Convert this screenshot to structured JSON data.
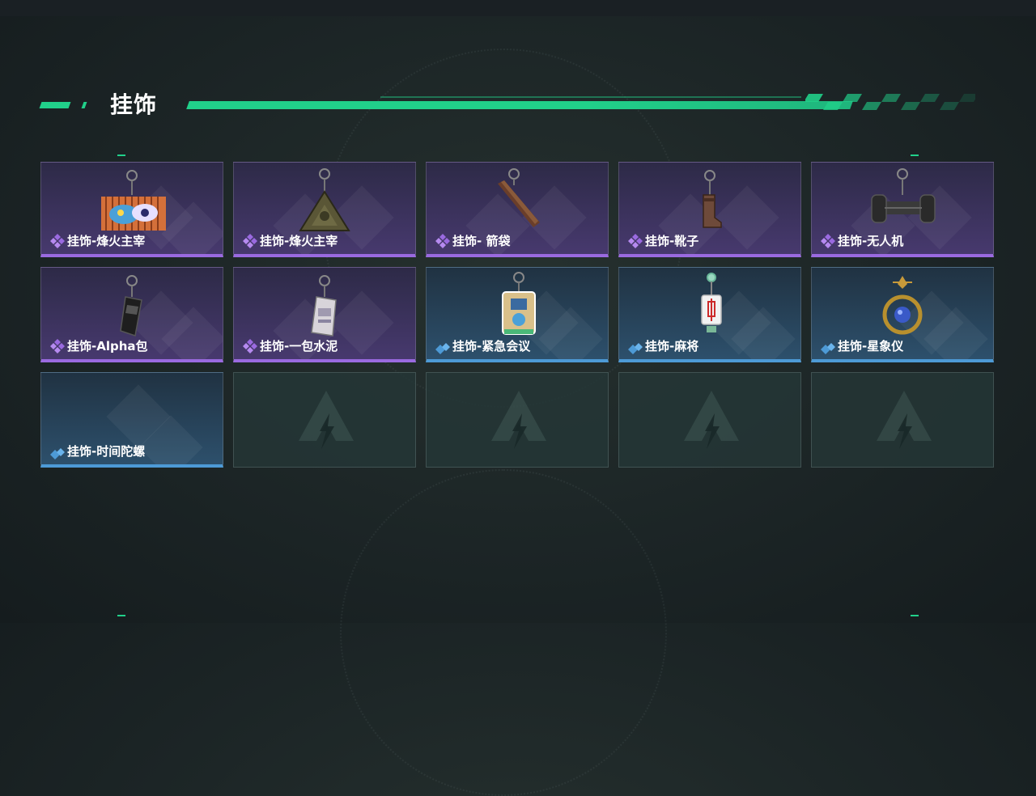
{
  "page": {
    "title": "挂饰"
  },
  "colors": {
    "accent": "#21d08a",
    "purple": "#9a6ae0",
    "blue": "#4d9ad6"
  },
  "items": [
    {
      "name": "挂饰-烽火主宰",
      "rarity": "purple",
      "icon": "colorful-panel-charm-icon"
    },
    {
      "name": "挂饰-烽火主宰",
      "rarity": "purple",
      "icon": "triangle-pendant-charm-icon"
    },
    {
      "name": "挂饰- 箭袋",
      "rarity": "purple",
      "icon": "quiver-charm-icon"
    },
    {
      "name": "挂饰-靴子",
      "rarity": "purple",
      "icon": "boot-charm-icon"
    },
    {
      "name": "挂饰-无人机",
      "rarity": "purple",
      "icon": "drone-charm-icon"
    },
    {
      "name": "挂饰-Alpha包",
      "rarity": "purple",
      "icon": "alpha-bag-charm-icon"
    },
    {
      "name": "挂饰-一包水泥",
      "rarity": "purple",
      "icon": "cement-bag-charm-icon"
    },
    {
      "name": "挂饰-紧急会议",
      "rarity": "blue",
      "icon": "emergency-meeting-charm-icon"
    },
    {
      "name": "挂饰-麻将",
      "rarity": "blue",
      "icon": "mahjong-tile-charm-icon"
    },
    {
      "name": "挂饰-星象仪",
      "rarity": "blue",
      "icon": "astrolabe-charm-icon"
    },
    {
      "name": "挂饰-时间陀螺",
      "rarity": "blue",
      "icon": "time-gyro-charm-icon"
    }
  ],
  "empty_slots": 4
}
